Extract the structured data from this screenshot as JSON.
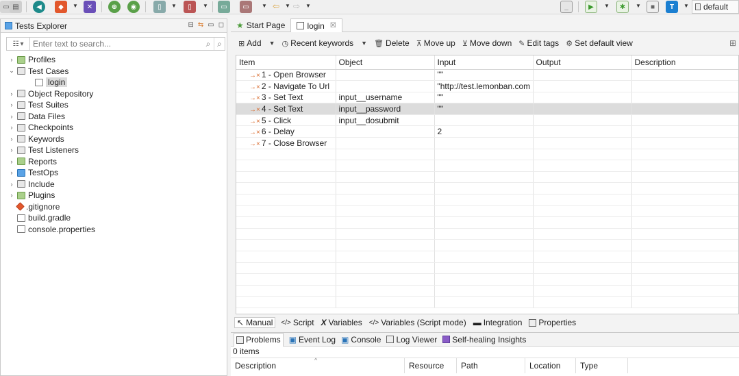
{
  "toolbar": {
    "profile": "default"
  },
  "explorer": {
    "title": "Tests Explorer",
    "search_placeholder": "Enter text to search...",
    "tree": [
      {
        "label": "Profiles",
        "indent": 0,
        "twisty": "›"
      },
      {
        "label": "Test Cases",
        "indent": 0,
        "twisty": "⌄"
      },
      {
        "label": "login",
        "indent": 1,
        "twisty": ""
      },
      {
        "label": "Object Repository",
        "indent": 0,
        "twisty": "›"
      },
      {
        "label": "Test Suites",
        "indent": 0,
        "twisty": "›"
      },
      {
        "label": "Data Files",
        "indent": 0,
        "twisty": "›"
      },
      {
        "label": "Checkpoints",
        "indent": 0,
        "twisty": "›"
      },
      {
        "label": "Keywords",
        "indent": 0,
        "twisty": "›"
      },
      {
        "label": "Test Listeners",
        "indent": 0,
        "twisty": "›"
      },
      {
        "label": "Reports",
        "indent": 0,
        "twisty": "›"
      },
      {
        "label": "TestOps",
        "indent": 0,
        "twisty": "›"
      },
      {
        "label": "Include",
        "indent": 0,
        "twisty": "›"
      },
      {
        "label": "Plugins",
        "indent": 0,
        "twisty": "›"
      },
      {
        "label": ".gitignore",
        "indent": 0,
        "twisty": ""
      },
      {
        "label": "build.gradle",
        "indent": 0,
        "twisty": ""
      },
      {
        "label": "console.properties",
        "indent": 0,
        "twisty": ""
      }
    ]
  },
  "editor": {
    "tabs": [
      {
        "label": "Start Page",
        "icon": "star-icon"
      },
      {
        "label": "login",
        "icon": "test-case-icon",
        "close": "☒"
      }
    ],
    "actions": {
      "add": "Add",
      "recent": "Recent keywords",
      "delete": "Delete",
      "move_up": "Move up",
      "move_down": "Move down",
      "edit_tags": "Edit tags",
      "set_default": "Set default view"
    },
    "columns": [
      "Item",
      "Object",
      "Input",
      "Output",
      "Description"
    ],
    "steps": [
      {
        "item": "1 - Open Browser",
        "object": "",
        "input": "\"\"",
        "output": "",
        "description": ""
      },
      {
        "item": "2 - Navigate To Url",
        "object": "",
        "input": "\"http://test.lemonban.com",
        "output": "",
        "description": ""
      },
      {
        "item": "3 - Set Text",
        "object": "input__username",
        "input": "\"\"",
        "output": "",
        "description": ""
      },
      {
        "item": "4 - Set Text",
        "object": "input__password",
        "input": "\"\"",
        "output": "",
        "description": ""
      },
      {
        "item": "5 - Click",
        "object": "input__dosubmit",
        "input": "",
        "output": "",
        "description": ""
      },
      {
        "item": "6 - Delay",
        "object": "",
        "input": "2",
        "output": "",
        "description": ""
      },
      {
        "item": "7 - Close Browser",
        "object": "",
        "input": "",
        "output": "",
        "description": ""
      }
    ],
    "selected_step": 3,
    "view_tabs": [
      "Manual",
      "Script",
      "Variables",
      "Variables (Script mode)",
      "Integration",
      "Properties"
    ]
  },
  "problems": {
    "tabs": [
      "Problems",
      "Event Log",
      "Console",
      "Log Viewer",
      "Self-healing Insights"
    ],
    "count": "0 items",
    "columns": [
      "Description",
      "Resource",
      "Path",
      "Location",
      "Type"
    ]
  }
}
